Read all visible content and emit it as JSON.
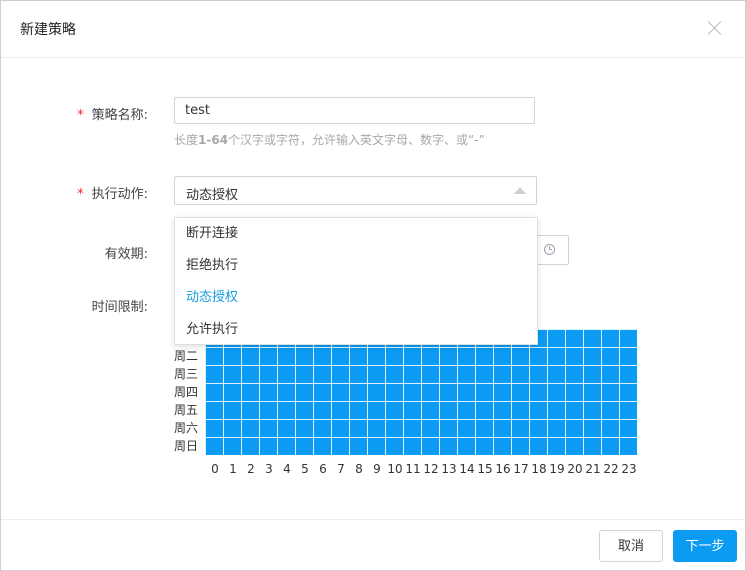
{
  "dialog": {
    "title": "新建策略"
  },
  "form": {
    "name_label": "策略名称:",
    "name_value": "test",
    "name_hint_prefix": "长度",
    "name_hint_range": "1-64",
    "name_hint_suffix": "个汉字或字符，允许输入英文字母、数字、或“-”",
    "action_label": "执行动作:",
    "action_value": "动态授权",
    "validity_label": "有效期:",
    "time_limit_label": "时间限制:",
    "required_mark": "*"
  },
  "dropdown": {
    "options": [
      "断开连接",
      "拒绝执行",
      "动态授权",
      "允许执行"
    ],
    "selected": "动态授权"
  },
  "schedule": {
    "days": [
      "周二",
      "周三",
      "周四",
      "周五",
      "周六",
      "周日"
    ],
    "hours": [
      "0",
      "1",
      "2",
      "3",
      "4",
      "5",
      "6",
      "7",
      "8",
      "9",
      "10",
      "11",
      "12",
      "13",
      "14",
      "15",
      "16",
      "17",
      "18",
      "19",
      "20",
      "21",
      "22",
      "23"
    ],
    "fill_color": "#0b9bf2"
  },
  "footer": {
    "cancel_label": "取消",
    "next_label": "下一步"
  }
}
